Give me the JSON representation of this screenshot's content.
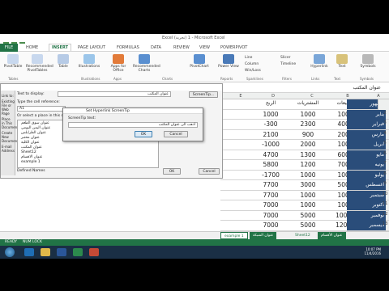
{
  "window": {
    "title": "Excel (تجربة) 1 - Microsoft Excel"
  },
  "ribbon_tabs": [
    "FILE",
    "HOME",
    "INSERT",
    "PAGE LAYOUT",
    "FORMULAS",
    "DATA",
    "REVIEW",
    "VIEW",
    "POWERPIVOT"
  ],
  "active_tab": "INSERT",
  "ribbon": {
    "groups": [
      "Tables",
      "Illustrations",
      "Apps",
      "Charts",
      "Reports",
      "Sparklines",
      "Filters",
      "Links",
      "Text",
      "Symbols"
    ],
    "buttons": [
      "PivotTable",
      "Recommended PivotTables",
      "Table",
      "Illustrations",
      "Apps for Office",
      "Recommended Charts",
      "PivotChart",
      "Power View",
      "Line",
      "Column",
      "Win/Loss",
      "Slicer",
      "Timeline",
      "Hyperlink",
      "Text",
      "Symbols"
    ]
  },
  "formula_bar": {
    "content": "عنوان المكتب"
  },
  "columns": [
    "E",
    "D",
    "C",
    "B",
    "A"
  ],
  "headers": {
    "profit": "الربح",
    "purchases": "المشتريات",
    "sales": "المبيعات",
    "month": "الشهور"
  },
  "rows": [
    {
      "num": "2",
      "month": "يناير",
      "sales": "1000",
      "purchases": "1000",
      "profit": "1000"
    },
    {
      "num": "3",
      "month": "فبراير",
      "sales": "4000",
      "purchases": "2300",
      "profit": "-300"
    },
    {
      "num": "4",
      "month": "مارس",
      "sales": "2000",
      "purchases": "900",
      "profit": "2100"
    },
    {
      "num": "5",
      "month": "ابريل",
      "sales": "1000",
      "purchases": "2000",
      "profit": "-1000"
    },
    {
      "num": "6",
      "month": "مايو",
      "sales": "6000",
      "purchases": "1300",
      "profit": "4700"
    },
    {
      "num": "7",
      "month": "يونيه",
      "sales": "7000",
      "purchases": "1200",
      "profit": "5800"
    },
    {
      "num": "8",
      "month": "يوليو",
      "sales": "1000",
      "purchases": "1000",
      "profit": "-1700"
    },
    {
      "num": "9",
      "month": "اغسطس",
      "sales": "5000",
      "purchases": "3000",
      "profit": "7700"
    },
    {
      "num": "10",
      "month": "سبتمبر",
      "sales": "1000",
      "purchases": "1000",
      "profit": "7700"
    },
    {
      "num": "11",
      "month": "اكتوبر",
      "sales": "1000",
      "purchases": "1000",
      "profit": "7000"
    },
    {
      "num": "12",
      "month": "نوفمبر",
      "sales": "10000",
      "purchases": "5000",
      "profit": "7000"
    },
    {
      "num": "13",
      "month": "ديسمبر",
      "sales": "12000",
      "purchases": "5000",
      "profit": "7000"
    }
  ],
  "row14": {
    "num": "14",
    "label": "ملخص"
  },
  "sheet_tabs": [
    "example 1",
    "عنوان الشبكة",
    "Sheet12",
    "عنوان الأقسام"
  ],
  "statusbar": {
    "left1": "READY",
    "left2": "NUM LOCK"
  },
  "clock": {
    "time": "10:07 PM",
    "date": "11/4/2016"
  },
  "insert_hyperlink_dialog": {
    "title": "Insert Hyperlink",
    "link_to": "Link to:",
    "text_to_display_label": "Text to display:",
    "text_to_display_value": "عنوان المكتب",
    "screentip_button": "ScreenTip...",
    "cell_ref_label": "Type the cell reference:",
    "cell_ref_value": "A1",
    "place_label": "Or select a place in this document:",
    "tree_items": [
      "عنوان سوق الطعم",
      "عنوان اليمن اليومي",
      "عنوان الطرابلس",
      "عنوان مختبر",
      "عنوان الكلية",
      "عنوان المكتب",
      "Sheet12",
      "عنوان الاقسام",
      "example 1"
    ],
    "defined_names": "Defined Names",
    "left_items": [
      "Existing File or Web Page",
      "Place in This Document",
      "Create New Document",
      "E-mail Address"
    ],
    "ok": "OK",
    "cancel": "Cancel"
  },
  "screentip_dialog": {
    "title": "Set Hyperlink ScreenTip",
    "label": "ScreenTip text:",
    "value": "اذهب الى عنوان المكتب",
    "ok": "OK",
    "cancel": "Cancel"
  },
  "colors": {
    "excel_green": "#217346",
    "month_cell": "#2a4d7a",
    "summary_orange": "#e8772a",
    "spark_blue": "#3b66b0"
  }
}
